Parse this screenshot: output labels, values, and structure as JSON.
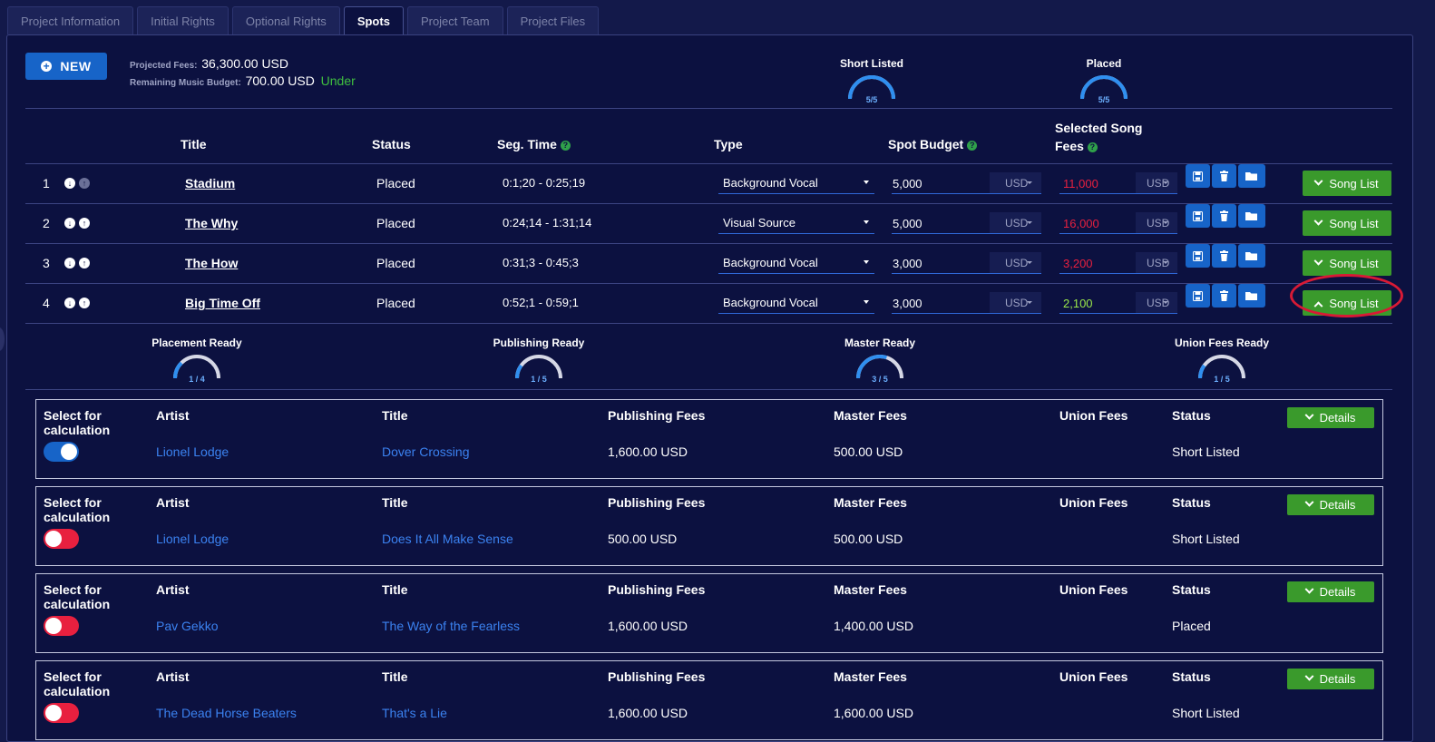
{
  "tabs": [
    "Project Information",
    "Initial Rights",
    "Optional Rights",
    "Spots",
    "Project Team",
    "Project Files"
  ],
  "active_tab": "Spots",
  "new_button": "NEW",
  "projected_fees": {
    "label": "Projected Fees:",
    "value": "36,300.00 USD"
  },
  "remaining_budget": {
    "label": "Remaining Music Budget:",
    "value": "700.00 USD",
    "status": "Under"
  },
  "top_gauges": [
    {
      "label": "Short Listed",
      "value": "5/5",
      "fraction": 1.0
    },
    {
      "label": "Placed",
      "value": "5/5",
      "fraction": 1.0
    }
  ],
  "table": {
    "headers": {
      "title": "Title",
      "status": "Status",
      "seg_time": "Seg. Time",
      "type": "Type",
      "spot_budget": "Spot Budget",
      "song_fees": "Selected Song Fees"
    },
    "rows": [
      {
        "num": "1",
        "title": "Stadium",
        "status": "Placed",
        "seg": "0:1;20 - 0:25;19",
        "type": "Background Vocal",
        "budget": "5,000",
        "currency": "USD",
        "fees": "11,000",
        "fees_color": "#e8203f",
        "button": "Song List",
        "expanded": false
      },
      {
        "num": "2",
        "title": "The Why",
        "status": "Placed",
        "seg": "0:24;14 - 1:31;14",
        "type": "Visual Source",
        "budget": "5,000",
        "currency": "USD",
        "fees": "16,000",
        "fees_color": "#e8203f",
        "button": "Song List",
        "expanded": false
      },
      {
        "num": "3",
        "title": "The How",
        "status": "Placed",
        "seg": "0:31;3 - 0:45;3",
        "type": "Background Vocal",
        "budget": "3,000",
        "currency": "USD",
        "fees": "3,200",
        "fees_color": "#e8203f",
        "button": "Song List",
        "expanded": false
      },
      {
        "num": "4",
        "title": "Big Time Off",
        "status": "Placed",
        "seg": "0:52;1 - 0:59;1",
        "type": "Background Vocal",
        "budget": "3,000",
        "currency": "USD",
        "fees": "2,100",
        "fees_color": "#9be84a",
        "button": "Song List",
        "expanded": true
      }
    ]
  },
  "ready_gauges": [
    {
      "label": "Placement Ready",
      "value": "1 / 4",
      "fraction": 0.25
    },
    {
      "label": "Publishing Ready",
      "value": "1 / 5",
      "fraction": 0.2
    },
    {
      "label": "Master Ready",
      "value": "3 / 5",
      "fraction": 0.6
    },
    {
      "label": "Union Fees Ready",
      "value": "1 / 5",
      "fraction": 0.2
    }
  ],
  "song_headers": {
    "select": "Select for calculation",
    "artist": "Artist",
    "title": "Title",
    "publishing": "Publishing Fees",
    "master": "Master Fees",
    "union": "Union Fees",
    "status": "Status",
    "details": "Details"
  },
  "songs": [
    {
      "selected": true,
      "artist": "Lionel Lodge",
      "title": "Dover Crossing",
      "publishing": "1,600.00 USD",
      "master": "500.00 USD",
      "union": "",
      "status": "Short Listed"
    },
    {
      "selected": false,
      "artist": "Lionel Lodge",
      "title": "Does It All Make Sense",
      "publishing": "500.00 USD",
      "master": "500.00 USD",
      "union": "",
      "status": "Short Listed"
    },
    {
      "selected": false,
      "artist": "Pav Gekko",
      "title": "The Way of the Fearless",
      "publishing": "1,600.00 USD",
      "master": "1,400.00 USD",
      "union": "",
      "status": "Placed"
    },
    {
      "selected": false,
      "artist": "The Dead Horse Beaters",
      "title": "That's a Lie",
      "publishing": "1,600.00 USD",
      "master": "1,600.00 USD",
      "union": "",
      "status": "Short Listed"
    }
  ],
  "icons": {
    "save": "save-icon",
    "delete": "trash-icon",
    "folder": "folder-icon",
    "help": "help-icon",
    "down": "arrow-down-icon",
    "up": "arrow-up-icon"
  },
  "colors": {
    "accent": "#1764c8",
    "success": "#3a9a2c",
    "danger": "#e8203f",
    "link": "#3b82f0",
    "highlight_oval": "#d81a35"
  }
}
